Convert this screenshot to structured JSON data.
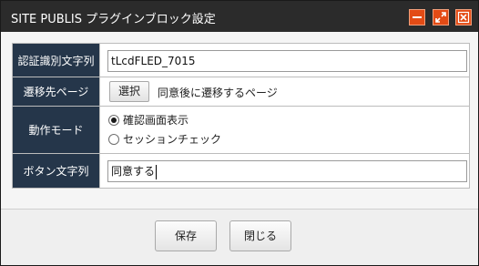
{
  "window": {
    "title": "SITE PUBLIS プラグインブロック設定",
    "controls": {
      "minimize_icon": "minimize-icon",
      "maximize_icon": "maximize-icon",
      "close_icon": "close-icon",
      "accent_color": "#e34b15"
    }
  },
  "form": {
    "label_bg_color": "#25364a",
    "auth_id": {
      "label": "認証識別文字列",
      "value": "tLcdFLED_7015"
    },
    "redirect": {
      "label": "遷移先ページ",
      "select_label": "選択",
      "note": "同意後に遷移するページ"
    },
    "mode": {
      "label": "動作モード",
      "options": [
        {
          "label": "確認画面表示",
          "selected": true
        },
        {
          "label": "セッションチェック",
          "selected": false
        }
      ]
    },
    "button_text": {
      "label": "ボタン文字列",
      "value": "同意する"
    }
  },
  "footer": {
    "save_label": "保存",
    "close_label": "閉じる"
  }
}
